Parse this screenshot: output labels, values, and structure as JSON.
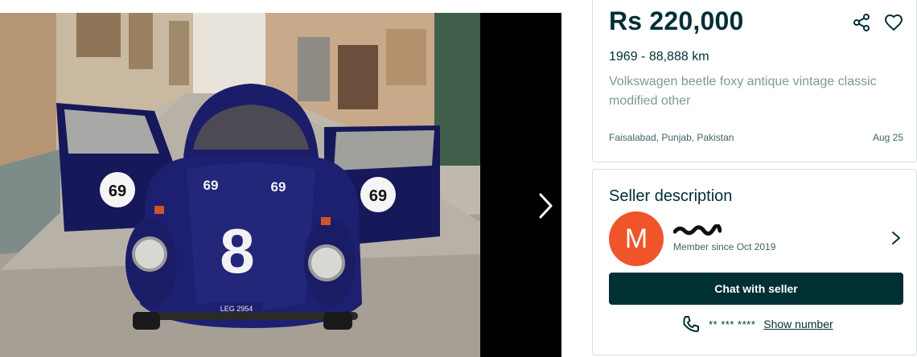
{
  "gallery": {
    "photo_alt": "Volkswagen beetle photo",
    "plate_text": "LEG 2954",
    "door_number": "69",
    "hood_number": "8"
  },
  "listing": {
    "price": "Rs 220,000",
    "year_km": "1969 - 88,888 km",
    "title": "Volkswagen beetle foxy antique vintage classic modified other",
    "location": "Faisalabad, Punjab, Pakistan",
    "date": "Aug 25"
  },
  "seller": {
    "heading": "Seller description",
    "avatar_letter": "M",
    "member_since": "Member since Oct 2019",
    "chat_label": "Chat with seller",
    "phone_masked": "** *** ****",
    "show_number_label": "Show number"
  },
  "colors": {
    "brand_dark": "#002f34",
    "avatar": "#f0542a",
    "muted_text": "#7f9799"
  },
  "icons": [
    "share-icon",
    "heart-icon",
    "chevron-right-icon",
    "phone-icon"
  ]
}
